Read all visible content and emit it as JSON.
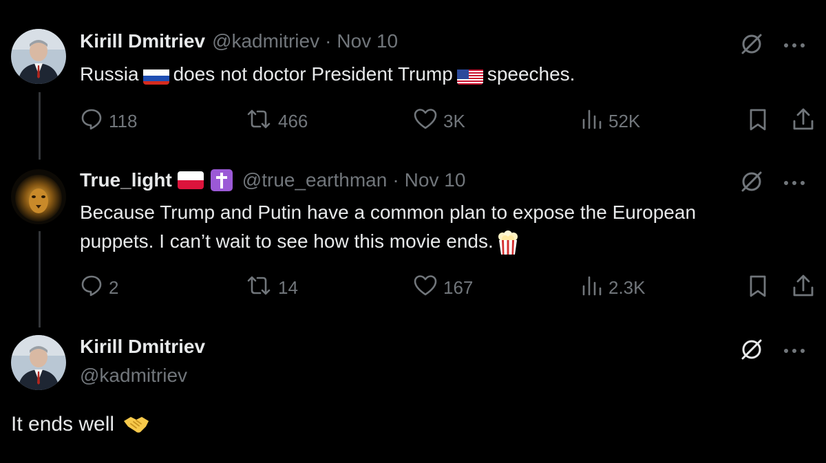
{
  "tweets": [
    {
      "name": "Kirill Dmitriev",
      "handle": "@kadmitriev",
      "sep": "·",
      "date": "Nov 10",
      "text_part1": "Russia",
      "text_part2": "does not doctor President Trump",
      "text_part3": "speeches.",
      "replies": "118",
      "reposts": "466",
      "likes": "3K",
      "views": "52K"
    },
    {
      "name": "True_light",
      "handle": "@true_earthman",
      "sep": "·",
      "date": "Nov 10",
      "text_line1": "Because Trump and Putin have a common plan to expose the European",
      "text_line2": "puppets. I can’t wait to see how this movie ends.",
      "replies": "2",
      "reposts": "14",
      "likes": "167",
      "views": "2.3K"
    }
  ],
  "main_tweet": {
    "name": "Kirill Dmitriev",
    "handle": "@kadmitriev",
    "text": "It ends well"
  },
  "colors": {
    "background": "#000000",
    "text": "#e7e9ea",
    "muted": "#71767b",
    "thread_line": "#333639"
  },
  "icons": [
    "grok-icon",
    "more-icon",
    "reply-icon",
    "repost-icon",
    "like-icon",
    "views-icon",
    "bookmark-icon",
    "share-icon"
  ]
}
